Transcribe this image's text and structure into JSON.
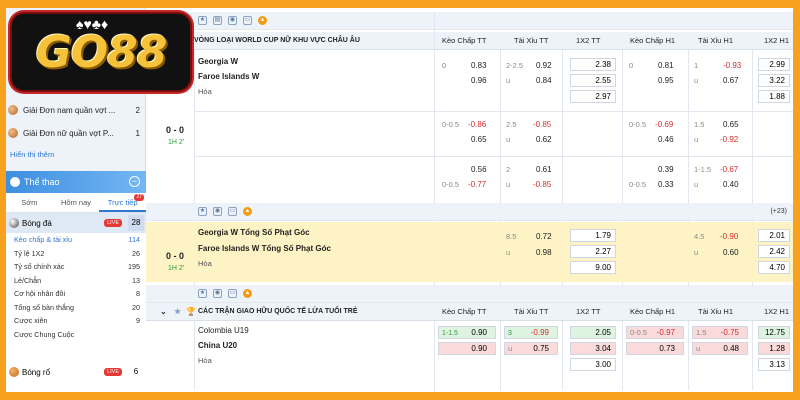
{
  "logo": {
    "text": "GO88",
    "cards": "♠♥♣♦"
  },
  "sidebar": {
    "items": [
      {
        "label": "Giải Đơn nam quần vợt ...",
        "count": "2"
      },
      {
        "label": "Giải Đơn nữ quần vợt P...",
        "count": "1"
      }
    ],
    "see_more": "Hiển thị thêm",
    "sports_title": "Thể thao",
    "tabs": [
      {
        "label": "Sớm"
      },
      {
        "label": "Hôm nay"
      },
      {
        "label": "Trực tiếp",
        "badge": "27"
      }
    ],
    "football": {
      "label": "Bóng đá",
      "live": "LIVE",
      "count": "28"
    },
    "subitems": [
      {
        "label": "Kèo chấp & tài xỉu",
        "count": "114"
      },
      {
        "label": "Tỷ lệ 1X2",
        "count": "26"
      },
      {
        "label": "Tỷ số chính xác",
        "count": "195"
      },
      {
        "label": "Lẻ/Chẵn",
        "count": "13"
      },
      {
        "label": "Cơ hội nhân đôi",
        "count": "8"
      },
      {
        "label": "Tổng số bàn thắng",
        "count": "20"
      },
      {
        "label": "Cược xiên",
        "count": "9"
      },
      {
        "label": "Cược Chung Cuộc",
        "count": ""
      }
    ],
    "basketball": {
      "label": "Bóng rổ",
      "live": "LIVE",
      "count": "6"
    }
  },
  "columns": [
    "Kèo Chấp TT",
    "Tài Xỉu TT",
    "1X2 TT",
    "Kèo Chấp H1",
    "Tài Xỉu H1",
    "1X2 H1"
  ],
  "league1": {
    "title": "VÒNG LOẠI WORLD CUP NỮ KHU VỰC CHÂU ÂU"
  },
  "match1": {
    "home": "Georgia W",
    "away": "Faroe Islands W",
    "draw": "Hòa",
    "score": "0 - 0",
    "minute": "1H 2'",
    "r1": {
      "hc": "0",
      "hc_h": "0.83",
      "hc_a": "0.96",
      "ou": "2-2.5",
      "ou_o": "0.92",
      "ou_u": "u",
      "ou_uv": "0.84",
      "x1": "2.38",
      "x2": "2.55",
      "x3": "2.97",
      "hc1": "0",
      "hc1_h": "0.81",
      "hc1_a": "0.95",
      "ou1": "1",
      "ou1_o": "-0.93",
      "ou1_u": "u",
      "ou1_uv": "0.67",
      "y1": "2.99",
      "y2": "3.22",
      "y3": "1.88"
    },
    "r2": {
      "hc": "0-0.5",
      "hc_h": "-0.86",
      "hc_a": "0.65",
      "ou": "2.5",
      "ou_o": "-0.85",
      "ou_u": "u",
      "ou_uv": "0.62",
      "hc1": "0-0.5",
      "hc1_h": "-0.69",
      "hc1_a": "0.46",
      "ou1": "1.5",
      "ou1_o": "0.65",
      "ou1_u": "u",
      "ou1_uv": "-0.92"
    },
    "r3": {
      "hc": "0-0.5",
      "hc_h": "0.56",
      "hc_a": "-0.77",
      "ou": "2",
      "ou_o": "0.61",
      "ou_u": "u",
      "ou_uv": "-0.85",
      "hc1": "0-0.5",
      "hc1_h": "0.39",
      "hc1_a": "0.33",
      "ou1": "1-1.5",
      "ou1_o": "-0.67",
      "ou1_u": "u",
      "ou1_uv": "0.40"
    }
  },
  "more_markets": "(+23)",
  "match2": {
    "home": "Georgia W Tổng Số Phạt Góc",
    "away": "Faroe Islands W Tổng Số Phạt Góc",
    "draw": "Hòa",
    "score": "0 - 0",
    "minute": "1H 2'",
    "ou": "8.5",
    "ou_o": "0.72",
    "ou_u": "u",
    "ou_uv": "0.98",
    "x1": "1.79",
    "x2": "2.27",
    "x3": "9.00",
    "ou1": "4.5",
    "ou1_o": "-0.90",
    "ou1_u": "u",
    "ou1_uv": "0.60",
    "y1": "2.01",
    "y2": "2.42",
    "y3": "4.70"
  },
  "league2": {
    "title": "CÁC TRẬN GIAO HỮU QUỐC TẾ LỨA TUỔI TRẺ"
  },
  "match3": {
    "home": "Colombia U19",
    "away": "China U20",
    "draw": "Hòa",
    "hc": "1-1.5",
    "hc_h": "0.90",
    "hc_a": "0.90",
    "ou": "3",
    "ou_o": "-0.99",
    "ou_u": "u",
    "ou_uv": "0.75",
    "x1": "2.05",
    "x2": "3.04",
    "x3": "3.00",
    "hc1": "0-0.5",
    "hc1_h": "-0.97",
    "hc1_a": "0.73",
    "ou1": "1.5",
    "ou1_o": "-0.75",
    "ou1_u": "u",
    "ou1_uv": "0.48",
    "y1": "12.75",
    "y2": "1.28",
    "y3": "3.13"
  }
}
